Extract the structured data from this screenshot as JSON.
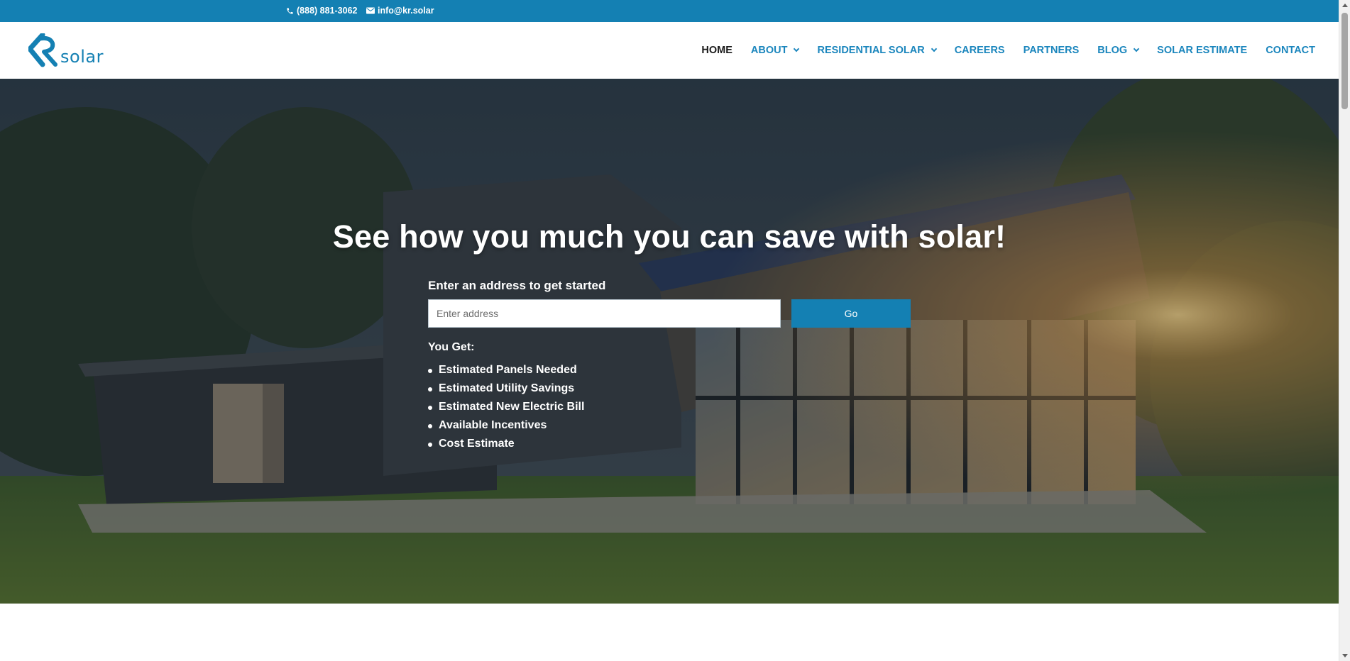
{
  "topbar": {
    "phone": "(888) 881-3062",
    "email": "info@kr.solar",
    "phone_icon": "phone-icon",
    "email_icon": "envelope-icon"
  },
  "header": {
    "logo_text": "solar",
    "nav": [
      {
        "label": "HOME",
        "active": true,
        "dropdown": false
      },
      {
        "label": "ABOUT",
        "active": false,
        "dropdown": true
      },
      {
        "label": "RESIDENTIAL SOLAR",
        "active": false,
        "dropdown": true
      },
      {
        "label": "CAREERS",
        "active": false,
        "dropdown": false
      },
      {
        "label": "PARTNERS",
        "active": false,
        "dropdown": false
      },
      {
        "label": "BLOG",
        "active": false,
        "dropdown": true
      },
      {
        "label": "SOLAR ESTIMATE",
        "active": false,
        "dropdown": false
      },
      {
        "label": "CONTACT",
        "active": false,
        "dropdown": false
      }
    ]
  },
  "hero": {
    "headline": "See how you much you can save with solar!",
    "form_label": "Enter an address to get started",
    "address_placeholder": "Enter address",
    "address_value": "",
    "go_label": "Go",
    "you_get_label": "You Get:",
    "benefits": [
      "Estimated Panels Needed",
      "Estimated Utility Savings",
      "Estimated New Electric Bill",
      "Available Incentives",
      "Cost Estimate"
    ]
  },
  "colors": {
    "brand": "#1480b3",
    "nav_text": "#1b86bd",
    "nav_active": "#1a1a1a",
    "white": "#ffffff"
  }
}
